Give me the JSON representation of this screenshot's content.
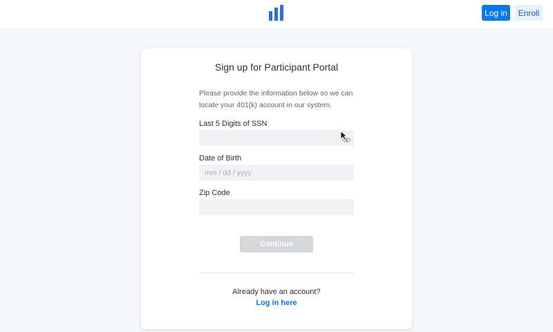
{
  "header": {
    "logo_icon": "bar-chart-logo",
    "login_label": "Log in",
    "enroll_label": "Enroll"
  },
  "card": {
    "title": "Sign up for Participant Portal",
    "intro": "Please provide the information below so we can locate your 401(k) account in our system.",
    "fields": [
      {
        "label": "Last 5 Digits of SSN",
        "value": "",
        "placeholder": ""
      },
      {
        "label": "Date of Birth",
        "value": "",
        "placeholder": "mm / dd / yyyy"
      },
      {
        "label": "Zip Code",
        "value": "",
        "placeholder": ""
      }
    ],
    "continue_label": "Continue",
    "already_text": "Already have an account?",
    "login_link": "Log in here"
  },
  "colors": {
    "primary": "#0a78e8",
    "page_bg": "#f4f6f9",
    "disabled_button": "#d6d7da"
  }
}
